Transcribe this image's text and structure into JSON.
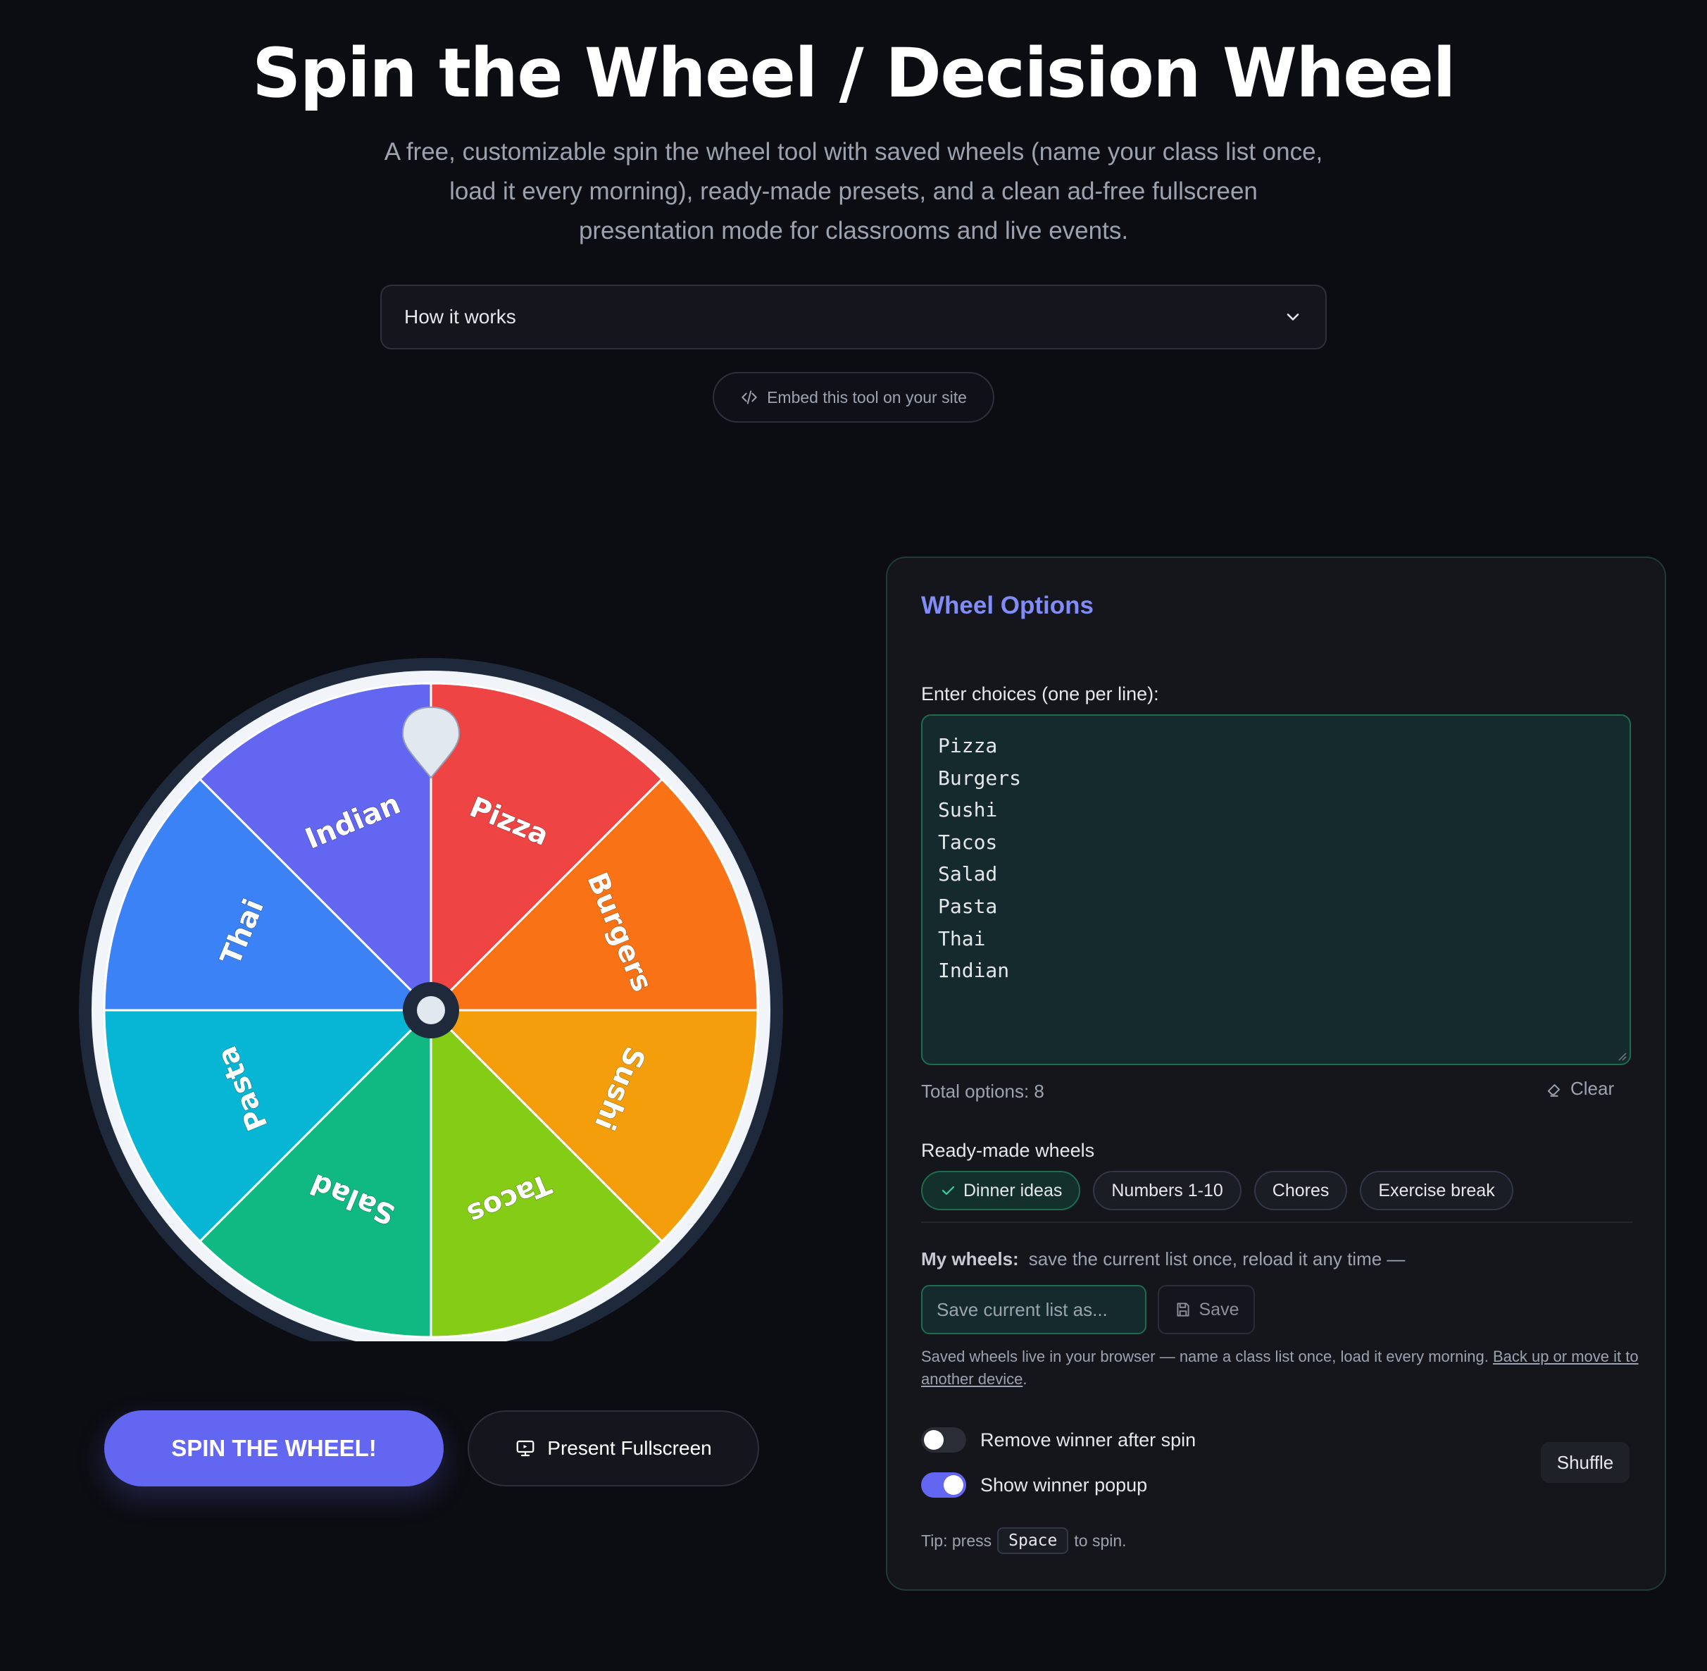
{
  "header": {
    "title": "Spin the Wheel / Decision Wheel",
    "subtitle": "A free, customizable spin the wheel tool with saved wheels (name your class list once, load it every morning), ready-made presets, and a clean ad-free fullscreen presentation mode for classrooms and live events.",
    "how_it_works": "How it works",
    "embed_label": "Embed this tool on your site"
  },
  "wheel": {
    "segments": [
      {
        "label": "Pizza",
        "color": "#ef4444"
      },
      {
        "label": "Burgers",
        "color": "#f97316"
      },
      {
        "label": "Sushi",
        "color": "#f59e0b"
      },
      {
        "label": "Tacos",
        "color": "#84cc16"
      },
      {
        "label": "Salad",
        "color": "#10b981"
      },
      {
        "label": "Pasta",
        "color": "#06b6d4"
      },
      {
        "label": "Thai",
        "color": "#3b82f6"
      },
      {
        "label": "Indian",
        "color": "#6366f1"
      }
    ],
    "rim_color": "#f1f5f9",
    "outer_ring_color": "#1e293b"
  },
  "actions": {
    "spin_label": "SPIN THE WHEEL!",
    "present_label": "Present Fullscreen"
  },
  "options": {
    "title": "Wheel Options",
    "choices_label": "Enter choices (one per line):",
    "choices_text": "Pizza\nBurgers\nSushi\nTacos\nSalad\nPasta\nThai\nIndian",
    "total_label": "Total options: 8",
    "clear_label": "Clear",
    "ready_label": "Ready-made wheels",
    "presets": [
      "Dinner ideas",
      "Numbers 1-10",
      "Chores",
      "Exercise break"
    ],
    "my_wheels_label": "My wheels:",
    "my_wheels_desc": "save the current list once, reload it any time —",
    "save_placeholder": "Save current list as...",
    "save_label": "Save",
    "note_text": "Saved wheels live in your browser — name a class list once, load it every morning.",
    "note_link": "Back up or move it to another device",
    "remove_winner_label": "Remove winner after spin",
    "show_popup_label": "Show winner popup",
    "shuffle_label": "Shuffle",
    "tip_prefix": "Tip: press",
    "tip_key": "Space",
    "tip_suffix": "to spin."
  },
  "colors": {
    "accent": "#6366f1",
    "panel_title": "#818cf8",
    "success_border": "#1f6b4f"
  }
}
